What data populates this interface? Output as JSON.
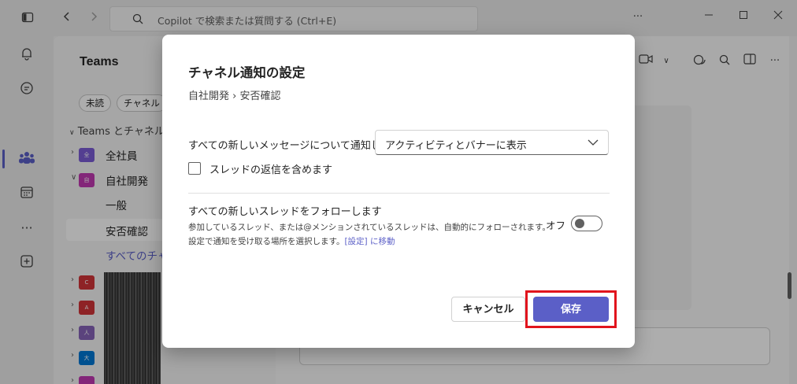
{
  "search": {
    "placeholder": "Copilot で検索または質問する (Ctrl+E)"
  },
  "panel": {
    "title": "Teams",
    "filters": [
      "未読",
      "チャネル"
    ],
    "tree_header": "Teams とチャネル",
    "teams": [
      {
        "name": "全社員",
        "avatar_text": "全",
        "color": "#7b5cd6"
      },
      {
        "name": "自社開発",
        "avatar_text": "自",
        "color": "#c239b3"
      }
    ],
    "channels": [
      "一般",
      "安否確認"
    ],
    "all_channels_link": "すべてのチャネ",
    "extra_teams": [
      {
        "avatar_text": "C",
        "color": "#d13438"
      },
      {
        "avatar_text": "A",
        "color": "#d13438"
      },
      {
        "avatar_text": "人",
        "color": "#8764b8"
      },
      {
        "avatar_text": "大",
        "color": "#0078d4"
      },
      {
        "avatar_text": "",
        "color": "#c239b3"
      }
    ]
  },
  "dialog": {
    "title": "チャネル通知の設定",
    "breadcrumb": "自社開発 › 安否確認",
    "all_messages_label": "すべての新しいメッセージについて通知します",
    "all_messages_value": "アクティビティとバナーに表示",
    "include_replies_label": "スレッドの返信を含めます",
    "include_replies_checked": false,
    "follow_title": "すべての新しいスレッドをフォローします",
    "follow_desc_line1": "参加しているスレッド、または@メンションされているスレッドは、自動的にフォローされます。",
    "follow_desc_line2": "設定で通知を受け取る場所を選択します。",
    "follow_link": "[設定] に移動",
    "toggle_label": "オフ",
    "toggle_on": false,
    "cancel_label": "キャンセル",
    "save_label": "保存"
  },
  "colors": {
    "accent": "#5b5fc7",
    "highlight": "#e1141d"
  }
}
